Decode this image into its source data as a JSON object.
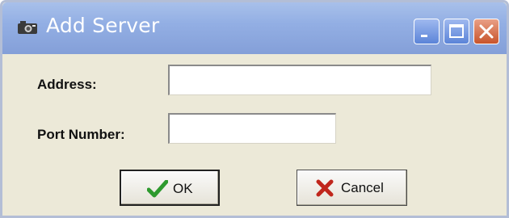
{
  "window": {
    "title": "Add Server",
    "title_icon": "camera-icon",
    "controls": [
      "minimize-icon",
      "maximize-icon",
      "close-icon"
    ]
  },
  "form": {
    "address_label": "Address:",
    "address_value": "",
    "port_label": "Port Number:",
    "port_value": ""
  },
  "buttons": {
    "ok_label": "OK",
    "ok_icon": "checkmark-icon",
    "cancel_label": "Cancel",
    "cancel_icon": "x-icon"
  },
  "colors": {
    "titlebar": "#93afe4",
    "dialog_background": "#ece9d8",
    "ok_check": "#2e9a2e",
    "cancel_x": "#c0261c"
  }
}
